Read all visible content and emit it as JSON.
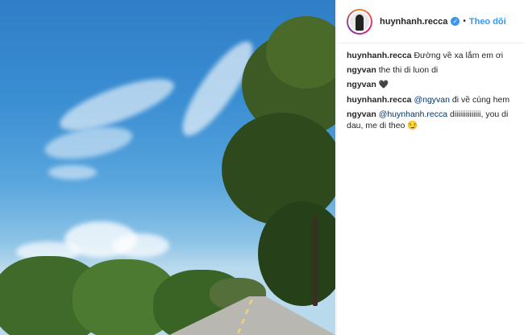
{
  "post": {
    "author": "huynhanh.recca",
    "verified_icon": "verified-badge-icon",
    "separator": "•",
    "follow_label": "Theo dõi"
  },
  "comments": [
    {
      "user": "huynhanh.recca",
      "text": "Đường về xa lắm em ơi"
    },
    {
      "user": "ngyvan",
      "text": "the thi di luon di"
    },
    {
      "user": "ngyvan",
      "emoji": "🖤"
    },
    {
      "user": "huynhanh.recca",
      "mention": "@ngyvan",
      "text": " đi về cùng hem"
    },
    {
      "user": "ngyvan",
      "mention": "@huynhanh.recca",
      "text": " diiiiiiiiiiiiii, you di dau, me di theo 😏"
    }
  ],
  "colors": {
    "accent": "#3897f0",
    "text": "#262626",
    "mention": "#003569"
  }
}
